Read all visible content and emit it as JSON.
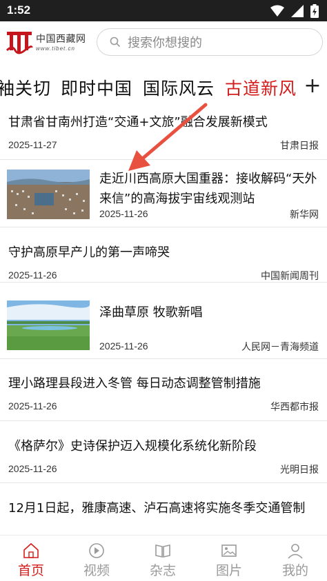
{
  "status": {
    "time": "1:52"
  },
  "header": {
    "logo_cn": "中国西藏网",
    "logo_url": "www.tibet.cn",
    "search_placeholder": "搜索你想搜的"
  },
  "tabs": [
    "袖关切",
    "即时中国",
    "国际风云",
    "古道新风"
  ],
  "active_tab": "古道新风",
  "news": [
    {
      "title": "甘肃省甘南州打造“交通+文旅”融合发展新模式",
      "date": "2025-11-27",
      "source": "甘肃日报"
    },
    {
      "title": "走近川西高原大国重器：接收解码“天外来信”的高海拔宇宙线观测站",
      "date": "2025-11-26",
      "source": "新华网"
    },
    {
      "title": "守护高原早产儿的第一声啼哭",
      "date": "2025-11-26",
      "source": "中国新闻周刊"
    },
    {
      "title": "泽曲草原 牧歌新唱",
      "date": "2025-11-26",
      "source": "人民网－青海频道"
    },
    {
      "title": "理小路理县段进入冬管 每日动态调整管制措施",
      "date": "2025-11-26",
      "source": "华西都市报"
    },
    {
      "title": "《格萨尔》史诗保护迈入规模化系统化新阶段",
      "date": "2025-11-26",
      "source": "光明日报"
    },
    {
      "title": "12月1日起，雅康高速、泸石高速将实施冬季交通管制",
      "date": "",
      "source": ""
    }
  ],
  "bottom_nav": [
    "首页",
    "视频",
    "杂志",
    "图片",
    "我的"
  ],
  "colors": {
    "accent": "#d31d1d",
    "inactive": "#9a9a9a",
    "statusbar": "#1f1f1f"
  }
}
